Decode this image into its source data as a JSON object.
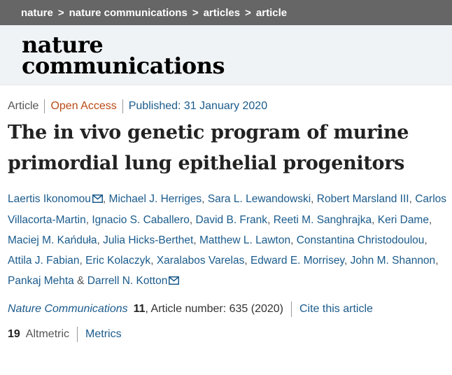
{
  "breadcrumb": {
    "items": [
      "nature",
      "nature communications",
      "articles",
      "article"
    ],
    "separator": ">"
  },
  "logo": {
    "line1": "nature",
    "line2": "communications"
  },
  "meta": {
    "type": "Article",
    "access": "Open Access",
    "published": "Published: 31 January 2020"
  },
  "title": "The in vivo genetic program of murine primordial lung epithelial progenitors",
  "authors": {
    "list": [
      "Laertis Ikonomou",
      "Michael J. Herriges",
      "Sara L. Lewandowski",
      "Robert Marsland III",
      "Carlos Villacorta-Martin",
      "Ignacio S. Caballero",
      "David B. Frank",
      "Reeti M. Sanghrajka",
      "Keri Dame",
      "Maciej M. Kańduła",
      "Julia Hicks-Berthet",
      "Matthew L. Lawton",
      "Constantina Christodoulou",
      "Attila J. Fabian",
      "Eric Kolaczyk",
      "Xaralabos Varelas",
      "Edward E. Morrisey",
      "John M. Shannon",
      "Pankaj Mehta",
      "Darrell N. Kotton"
    ],
    "comma": ",",
    "ampersand": "&"
  },
  "citation": {
    "journal": "Nature Communications",
    "volume": "11",
    "article_number": ", Article number: 635 (2020)",
    "cite_link": "Cite this article"
  },
  "metrics": {
    "altmetric_count": "19",
    "altmetric_label": "Altmetric",
    "metrics_link": "Metrics"
  },
  "icons": {
    "mail": "mail-icon"
  },
  "colors": {
    "link": "#1b5b8c",
    "open_access": "#b94a16",
    "breadcrumb_bg": "#666666",
    "masthead_bg": "#f0f3f5"
  }
}
